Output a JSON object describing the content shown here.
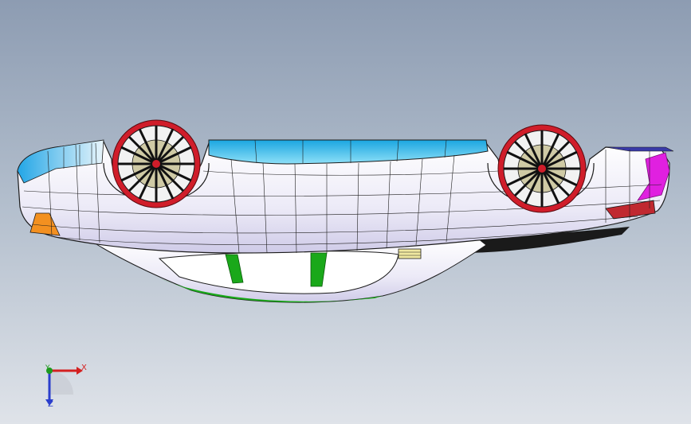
{
  "viewport": {
    "background_top": "#8d9cb2",
    "background_bottom": "#dfe3e9"
  },
  "model": {
    "name": "car-body-wireframe",
    "orientation": "upside-down",
    "colors": {
      "body": "#ffffff",
      "body_shade": "#e4e0f4",
      "mesh": "#1c1c1c",
      "window": "#21b5e6",
      "window_light": "#7fd8f5",
      "rim": "#d01d2a",
      "tire_inner": "#f2f2f2",
      "spoke": "#111111",
      "orange": "#f39020",
      "magenta": "#e020e0",
      "green": "#1aa81a",
      "taillight": "#c02830",
      "underbody": "#1a1a1a"
    }
  },
  "triad": {
    "x_label": "X",
    "y_label": "Y",
    "z_label": "Z",
    "x_color": "#d42020",
    "y_color": "#1e9a1e",
    "z_color": "#2b3ecc"
  }
}
